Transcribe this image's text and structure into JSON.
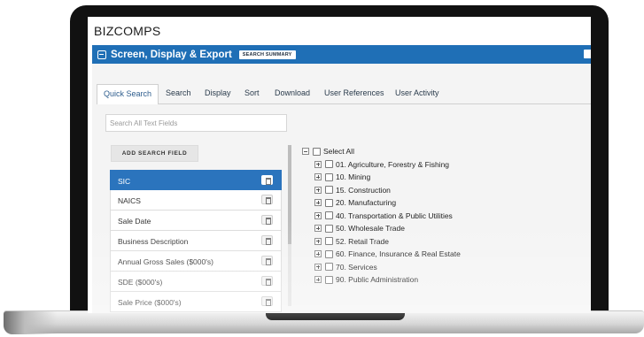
{
  "app": {
    "brand": "BIZCOMPS"
  },
  "panel_header": {
    "title": "Screen, Display & Export",
    "badge": "SEARCH SUMMARY"
  },
  "tabs": [
    {
      "label": "Quick Search",
      "active": true
    },
    {
      "label": "Search"
    },
    {
      "label": "Display"
    },
    {
      "label": "Sort"
    },
    {
      "label": "Download"
    },
    {
      "label": "User References"
    },
    {
      "label": "User Activity"
    }
  ],
  "search": {
    "placeholder": "Search All Text Fields",
    "value": ""
  },
  "add_field_button": "ADD SEARCH FIELD",
  "search_fields": [
    {
      "label": "SIC",
      "selected": true
    },
    {
      "label": "NAICS"
    },
    {
      "label": "Sale Date"
    },
    {
      "label": "Business Description"
    },
    {
      "label": "Annual Gross Sales ($000's)"
    },
    {
      "label": "SDE ($000's)"
    },
    {
      "label": "Sale Price ($000's)"
    }
  ],
  "sic_tree": {
    "select_all": "Select All",
    "items": [
      "01. Agriculture, Forestry & Fishing",
      "10. Mining",
      "15. Construction",
      "20. Manufacturing",
      "40. Transportation & Public Utilities",
      "50. Wholesale Trade",
      "52. Retail Trade",
      "60. Finance, Insurance & Real Estate",
      "70. Services",
      "90. Public Administration"
    ]
  },
  "colors": {
    "header_blue": "#1f6fb6",
    "selected_blue": "#2b74bd"
  }
}
